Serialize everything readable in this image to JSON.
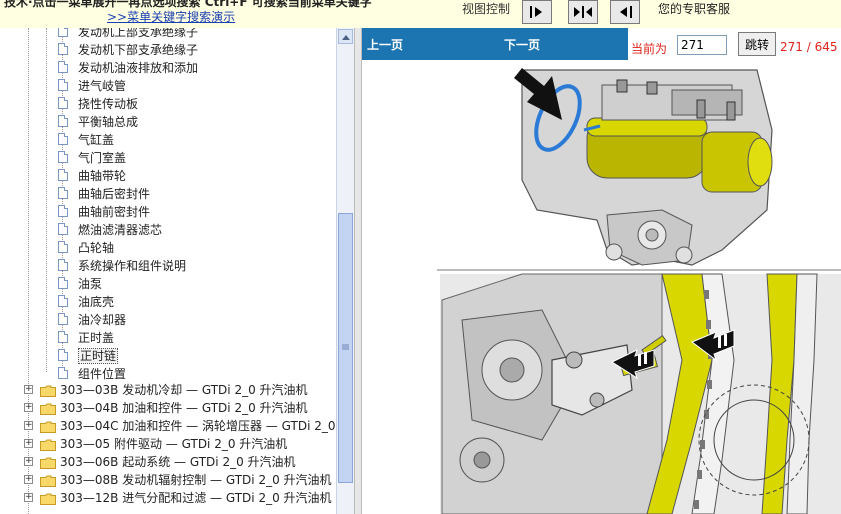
{
  "window": {
    "title_partial": "技术·点击一菜单展开一再点选项搜索   Ctrl+F 可搜索当前菜单关键字",
    "search_demo_link": ">>菜单关键字搜索演示",
    "view_control_label": "视图控制",
    "service_text": "您的专职客服"
  },
  "toolbar": {
    "buttons": [
      {
        "icon": "arrow-right-icon"
      },
      {
        "icon": "collapse-both-icon"
      },
      {
        "icon": "arrow-left-icon"
      }
    ]
  },
  "tree": {
    "items": [
      {
        "label": "发动机上部支承绝缘子",
        "kind": "doc"
      },
      {
        "label": "发动机下部支承绝缘子",
        "kind": "doc"
      },
      {
        "label": "发动机油液排放和添加",
        "kind": "doc"
      },
      {
        "label": "进气岐管",
        "kind": "doc"
      },
      {
        "label": "挠性传动板",
        "kind": "doc"
      },
      {
        "label": "平衡轴总成",
        "kind": "doc"
      },
      {
        "label": "气缸盖",
        "kind": "doc"
      },
      {
        "label": "气门室盖",
        "kind": "doc"
      },
      {
        "label": "曲轴带轮",
        "kind": "doc"
      },
      {
        "label": "曲轴后密封件",
        "kind": "doc"
      },
      {
        "label": "曲轴前密封件",
        "kind": "doc"
      },
      {
        "label": "燃油滤清器滤芯",
        "kind": "doc"
      },
      {
        "label": "凸轮轴",
        "kind": "doc"
      },
      {
        "label": "系统操作和组件说明",
        "kind": "doc"
      },
      {
        "label": "油泵",
        "kind": "doc"
      },
      {
        "label": "油底壳",
        "kind": "doc"
      },
      {
        "label": "油冷却器",
        "kind": "doc"
      },
      {
        "label": "正时盖",
        "kind": "doc"
      },
      {
        "label": "正时链",
        "kind": "doc",
        "selected": true
      },
      {
        "label": "组件位置",
        "kind": "doc"
      },
      {
        "label": "303—03B 发动机冷却 — GTDi 2_0 升汽油机",
        "kind": "folder"
      },
      {
        "label": "303—04B 加油和控件 — GTDi 2_0 升汽油机",
        "kind": "folder"
      },
      {
        "label": "303—04C 加油和控件 — 涡轮增压器 — GTDi 2_0",
        "kind": "folder"
      },
      {
        "label": "303—05 附件驱动 — GTDi 2_0 升汽油机",
        "kind": "folder"
      },
      {
        "label": "303—06B 起动系统 — GTDi 2_0 升汽油机",
        "kind": "folder"
      },
      {
        "label": "303—08B 发动机辐射控制 — GTDi 2_0 升汽油机",
        "kind": "folder"
      },
      {
        "label": "303—12B 进气分配和过滤 — GTDi 2_0 升汽油机",
        "kind": "folder"
      }
    ]
  },
  "viewer": {
    "prev_label": "上一页",
    "next_label": "下一页",
    "current_label": "当前为",
    "page_input_value": "271",
    "jump_label": "跳转",
    "page_count": "271 / 645"
  },
  "colors": {
    "nav_bar": "#1c74b0",
    "page_red": "#e0241b",
    "toolbar_bg": "#ffffe1",
    "part_yellow": "#d8d800"
  }
}
